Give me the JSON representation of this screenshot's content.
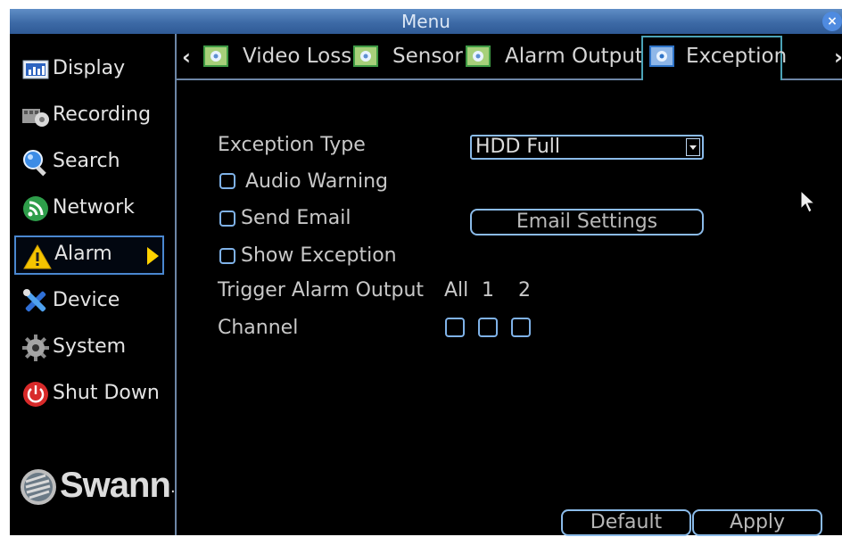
{
  "window": {
    "title": "Menu",
    "close_label": "×"
  },
  "sidebar": {
    "items": [
      {
        "label": "Display",
        "icon": "display-icon"
      },
      {
        "label": "Recording",
        "icon": "recording-icon"
      },
      {
        "label": "Search",
        "icon": "search-icon"
      },
      {
        "label": "Network",
        "icon": "network-icon"
      },
      {
        "label": "Alarm",
        "icon": "warning-icon",
        "active": true
      },
      {
        "label": "Device",
        "icon": "tools-icon"
      },
      {
        "label": "System",
        "icon": "gear-icon"
      },
      {
        "label": "Shut Down",
        "icon": "power-icon"
      }
    ],
    "logo_text": "Swann",
    "logo_mark": "."
  },
  "tabs": {
    "prev_arrow": "‹",
    "next_arrow": "›",
    "items": [
      {
        "label": "Video Loss",
        "icon": "settings-image-icon"
      },
      {
        "label": "Sensor",
        "icon": "settings-image-icon"
      },
      {
        "label": "Alarm Output",
        "icon": "settings-image-icon"
      },
      {
        "label": "Exception",
        "icon": "settings-image-icon",
        "active": true
      }
    ]
  },
  "form": {
    "exception_type_label": "Exception Type",
    "exception_type_value": "HDD Full",
    "audio_warning_label": "Audio Warning",
    "audio_warning_checked": false,
    "send_email_label": "Send Email",
    "send_email_checked": false,
    "email_settings_label": "Email Settings",
    "show_exception_label": "Show Exception",
    "show_exception_checked": false,
    "trigger_label": "Trigger Alarm Output",
    "trigger_cols": [
      "All",
      "1",
      "2"
    ],
    "channel_label": "Channel"
  },
  "footer": {
    "default_label": "Default",
    "apply_label": "Apply"
  },
  "colors": {
    "accent": "#4a87d0",
    "title_bar": "#3d6aa6",
    "active_tab_border": "#4ba3b7",
    "warning": "#ffd200"
  }
}
